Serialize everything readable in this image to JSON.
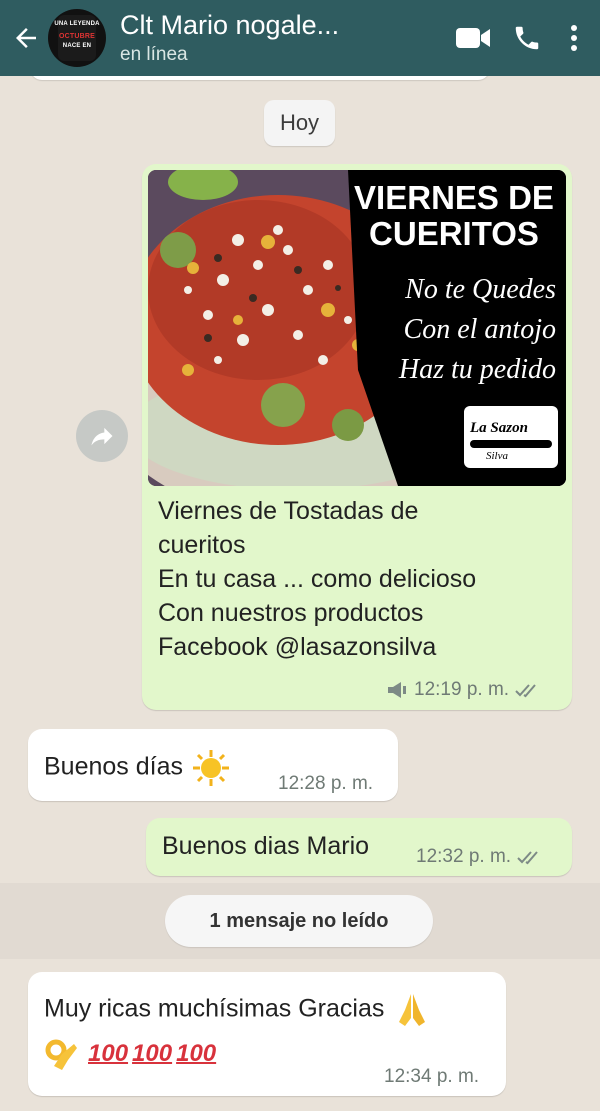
{
  "header": {
    "contact_name": "Clt Mario nogale...",
    "status": "en línea",
    "avatar_text": [
      "UNA LEYENDA",
      "OCTUBRE",
      "NACE EN"
    ],
    "icons": [
      "back-arrow-icon",
      "video-call-icon",
      "phone-icon",
      "more-options-icon"
    ]
  },
  "chat": {
    "date_chip": "Hoy",
    "image_message": {
      "poster": {
        "headline_1": "VIERNES DE",
        "headline_2": "CUERITOS",
        "script_1": "No te Quedes",
        "script_2": "Con el antojo",
        "script_3": "Haz tu pedido",
        "logo_top": "La Sazon",
        "logo_bottom": "Silva"
      },
      "caption_lines": [
        "Viernes de Tostadas de",
        "cueritos",
        "En tu casa ... como delicioso",
        "Con nuestros productos",
        "Facebook @lasazonsilva"
      ],
      "time": "12:19 p. m."
    },
    "msg_in_1": {
      "text": "Buenos días",
      "emoji": "sun",
      "time": "12:28 p. m."
    },
    "msg_out_2": {
      "text": "Buenos dias Mario",
      "time": "12:32 p. m."
    },
    "unread_divider": "1 mensaje no leído",
    "msg_in_2": {
      "text": "Muy ricas muchísimas Gracias",
      "emoji_line_hundreds": [
        "100",
        "100",
        "100"
      ],
      "time": "12:34 p. m."
    }
  },
  "colors": {
    "header": "#2f5c60",
    "outgoing_bubble": "#e2f7cb",
    "incoming_bubble": "#ffffff",
    "chat_background": "#e9e2d9",
    "read_ticks": "#7d8a86"
  }
}
